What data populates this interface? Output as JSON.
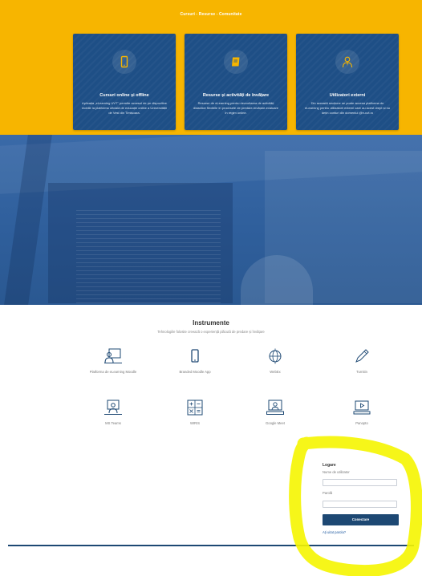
{
  "header": {
    "subtitle": "Cursuri - Resurse - Comunitate"
  },
  "cards": [
    {
      "title": "Cursuri online și offline",
      "text": "Aplicația „eLearning UVT\" permite accesul de pe dispozitive mobile la platforma oficială de educație online a Universității de Vest din Timișoara.",
      "icon": "phone-icon"
    },
    {
      "title": "Resurse și activități de învățare",
      "text": "Resurse de eLearning pentru dezvoltarea de activități didactice flexibile în procesele de predare-învățare-evaluare în regim online.",
      "icon": "book-icon"
    },
    {
      "title": "Utilizatori externi",
      "text": "Din această secțiune se poate accesa platforma de eLearning pentru utilizatorii externi care au acest drept și nu dețin conturi din domeniul @e-uvt.ro",
      "icon": "user-tie-icon"
    }
  ],
  "instruments": {
    "title": "Instrumente",
    "subtitle": "Tehnologiile folosite creează o experiență plăcută de predare și învățare",
    "tools": [
      {
        "label": "Platforma de eLearning Moodle",
        "icon": "teacher-screen-icon"
      },
      {
        "label": "Branded Moodle App",
        "icon": "mobile-icon"
      },
      {
        "label": "WebEx",
        "icon": "webex-icon"
      },
      {
        "label": "Turnitin",
        "icon": "pen-icon"
      },
      {
        "label": "MS Teams",
        "icon": "teams-icon"
      },
      {
        "label": "WIRIS",
        "icon": "math-icon"
      },
      {
        "label": "Google Meet",
        "icon": "video-call-icon"
      },
      {
        "label": "Panopto",
        "icon": "play-screen-icon"
      }
    ]
  },
  "login": {
    "title": "Logare",
    "username_label": "Nume de utilizator",
    "username_value": "",
    "password_label": "Parolă",
    "password_value": "",
    "submit_label": "Conectare",
    "forgot_label": "Ați uitat parola?"
  },
  "colors": {
    "brand_yellow": "#f7b500",
    "card_blue": "#1e4f86",
    "button_blue": "#1d4873",
    "highlighter": "#f5f500"
  }
}
